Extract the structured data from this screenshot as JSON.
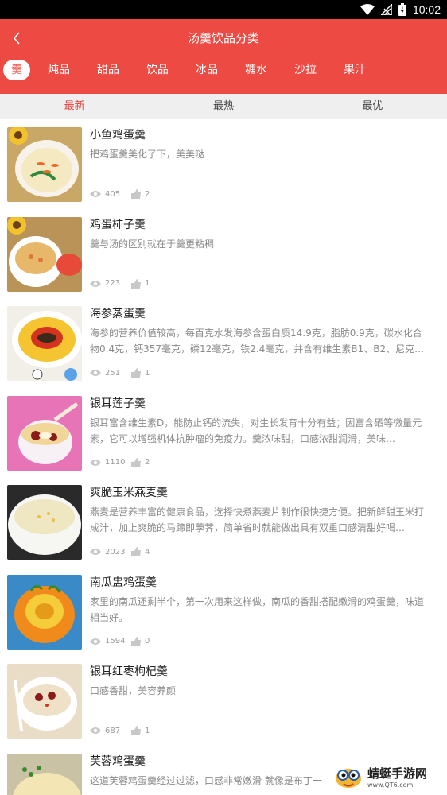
{
  "status_bar": {
    "time": "10:02"
  },
  "header": {
    "title": "汤羹饮品分类"
  },
  "categories": [
    {
      "label": "羹",
      "active": true
    },
    {
      "label": "炖品"
    },
    {
      "label": "甜品"
    },
    {
      "label": "饮品"
    },
    {
      "label": "冰品"
    },
    {
      "label": "糖水"
    },
    {
      "label": "沙拉"
    },
    {
      "label": "果汁"
    }
  ],
  "sort_tabs": [
    {
      "label": "最新",
      "active": true
    },
    {
      "label": "最热"
    },
    {
      "label": "最优"
    }
  ],
  "recipes": [
    {
      "name": "小鱼鸡蛋羹",
      "desc": "把鸡蛋羹美化了下，美美哒",
      "views": "405",
      "likes": "2"
    },
    {
      "name": "鸡蛋柿子羹",
      "desc": "羹与汤的区别就在于羹更粘稠",
      "views": "223",
      "likes": "1"
    },
    {
      "name": "海参蒸蛋羹",
      "desc": "海参的营养价值较高，每百克水发海参含蛋白质14.9克，脂肪0.9克，碳水化合物0.4克，钙357毫克，磷12毫克，铁2.4毫克，并含有维生素B1、B2、尼克…",
      "views": "251",
      "likes": "1"
    },
    {
      "name": "银耳莲子羹",
      "desc": "银耳富含维生素D，能防止钙的流失，对生长发育十分有益；因富含硒等微量元素，它可以增强机体抗肿瘤的免疫力。羹浓味甜，口感浓甜润滑，美味…",
      "views": "1110",
      "likes": "2"
    },
    {
      "name": "爽脆玉米燕麦羹",
      "desc": "燕麦是营养丰富的健康食品，选择快煮燕麦片制作很快捷方便。把新鲜甜玉米打成汁，加上爽脆的马蹄即荸荠，简单省时就能做出具有双重口感清甜好喝…",
      "views": "2023",
      "likes": "4"
    },
    {
      "name": "南瓜盅鸡蛋羹",
      "desc": "家里的南瓜还剩半个，第一次用来这样做，南瓜的香甜搭配嫩滑的鸡蛋羹，味道相当好。",
      "views": "1594",
      "likes": "0"
    },
    {
      "name": "银耳红枣枸杞羹",
      "desc": "口感香甜，美容养颜",
      "views": "687",
      "likes": "1"
    },
    {
      "name": "芙蓉鸡蛋羹",
      "desc": "这道芙蓉鸡蛋羹经过过滤，口感非常嫩滑 就像是布丁一",
      "views": "",
      "likes": ""
    }
  ],
  "watermark": {
    "name": "蜻蜓手游网",
    "url": "www.QT6.com"
  },
  "icons": {
    "back": "chevron-left-icon",
    "views": "eye-icon",
    "likes": "thumbs-up-icon"
  },
  "colors": {
    "brand_red": "#ee4a44",
    "active_tab": "#e5423c"
  }
}
